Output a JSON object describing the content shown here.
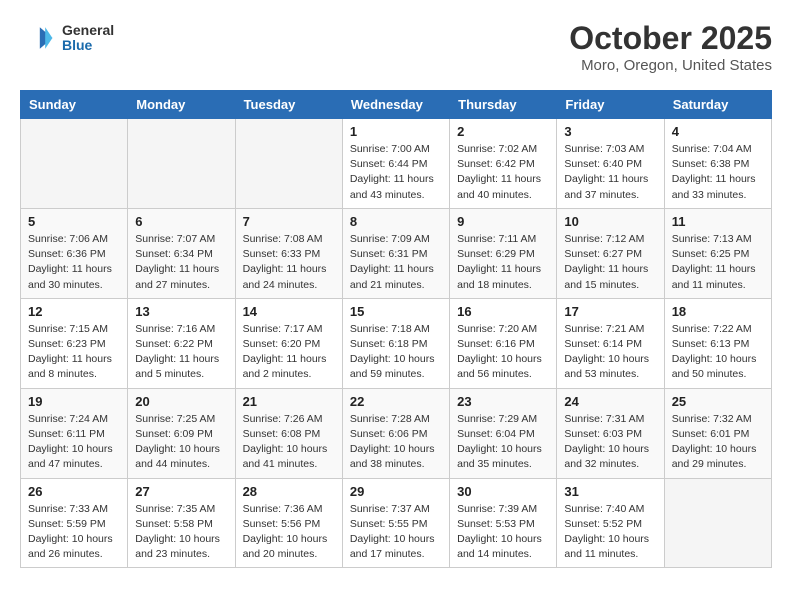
{
  "header": {
    "logo_general": "General",
    "logo_blue": "Blue",
    "month_title": "October 2025",
    "location": "Moro, Oregon, United States"
  },
  "weekdays": [
    "Sunday",
    "Monday",
    "Tuesday",
    "Wednesday",
    "Thursday",
    "Friday",
    "Saturday"
  ],
  "weeks": [
    [
      {
        "day": "",
        "info": ""
      },
      {
        "day": "",
        "info": ""
      },
      {
        "day": "",
        "info": ""
      },
      {
        "day": "1",
        "info": "Sunrise: 7:00 AM\nSunset: 6:44 PM\nDaylight: 11 hours\nand 43 minutes."
      },
      {
        "day": "2",
        "info": "Sunrise: 7:02 AM\nSunset: 6:42 PM\nDaylight: 11 hours\nand 40 minutes."
      },
      {
        "day": "3",
        "info": "Sunrise: 7:03 AM\nSunset: 6:40 PM\nDaylight: 11 hours\nand 37 minutes."
      },
      {
        "day": "4",
        "info": "Sunrise: 7:04 AM\nSunset: 6:38 PM\nDaylight: 11 hours\nand 33 minutes."
      }
    ],
    [
      {
        "day": "5",
        "info": "Sunrise: 7:06 AM\nSunset: 6:36 PM\nDaylight: 11 hours\nand 30 minutes."
      },
      {
        "day": "6",
        "info": "Sunrise: 7:07 AM\nSunset: 6:34 PM\nDaylight: 11 hours\nand 27 minutes."
      },
      {
        "day": "7",
        "info": "Sunrise: 7:08 AM\nSunset: 6:33 PM\nDaylight: 11 hours\nand 24 minutes."
      },
      {
        "day": "8",
        "info": "Sunrise: 7:09 AM\nSunset: 6:31 PM\nDaylight: 11 hours\nand 21 minutes."
      },
      {
        "day": "9",
        "info": "Sunrise: 7:11 AM\nSunset: 6:29 PM\nDaylight: 11 hours\nand 18 minutes."
      },
      {
        "day": "10",
        "info": "Sunrise: 7:12 AM\nSunset: 6:27 PM\nDaylight: 11 hours\nand 15 minutes."
      },
      {
        "day": "11",
        "info": "Sunrise: 7:13 AM\nSunset: 6:25 PM\nDaylight: 11 hours\nand 11 minutes."
      }
    ],
    [
      {
        "day": "12",
        "info": "Sunrise: 7:15 AM\nSunset: 6:23 PM\nDaylight: 11 hours\nand 8 minutes."
      },
      {
        "day": "13",
        "info": "Sunrise: 7:16 AM\nSunset: 6:22 PM\nDaylight: 11 hours\nand 5 minutes."
      },
      {
        "day": "14",
        "info": "Sunrise: 7:17 AM\nSunset: 6:20 PM\nDaylight: 11 hours\nand 2 minutes."
      },
      {
        "day": "15",
        "info": "Sunrise: 7:18 AM\nSunset: 6:18 PM\nDaylight: 10 hours\nand 59 minutes."
      },
      {
        "day": "16",
        "info": "Sunrise: 7:20 AM\nSunset: 6:16 PM\nDaylight: 10 hours\nand 56 minutes."
      },
      {
        "day": "17",
        "info": "Sunrise: 7:21 AM\nSunset: 6:14 PM\nDaylight: 10 hours\nand 53 minutes."
      },
      {
        "day": "18",
        "info": "Sunrise: 7:22 AM\nSunset: 6:13 PM\nDaylight: 10 hours\nand 50 minutes."
      }
    ],
    [
      {
        "day": "19",
        "info": "Sunrise: 7:24 AM\nSunset: 6:11 PM\nDaylight: 10 hours\nand 47 minutes."
      },
      {
        "day": "20",
        "info": "Sunrise: 7:25 AM\nSunset: 6:09 PM\nDaylight: 10 hours\nand 44 minutes."
      },
      {
        "day": "21",
        "info": "Sunrise: 7:26 AM\nSunset: 6:08 PM\nDaylight: 10 hours\nand 41 minutes."
      },
      {
        "day": "22",
        "info": "Sunrise: 7:28 AM\nSunset: 6:06 PM\nDaylight: 10 hours\nand 38 minutes."
      },
      {
        "day": "23",
        "info": "Sunrise: 7:29 AM\nSunset: 6:04 PM\nDaylight: 10 hours\nand 35 minutes."
      },
      {
        "day": "24",
        "info": "Sunrise: 7:31 AM\nSunset: 6:03 PM\nDaylight: 10 hours\nand 32 minutes."
      },
      {
        "day": "25",
        "info": "Sunrise: 7:32 AM\nSunset: 6:01 PM\nDaylight: 10 hours\nand 29 minutes."
      }
    ],
    [
      {
        "day": "26",
        "info": "Sunrise: 7:33 AM\nSunset: 5:59 PM\nDaylight: 10 hours\nand 26 minutes."
      },
      {
        "day": "27",
        "info": "Sunrise: 7:35 AM\nSunset: 5:58 PM\nDaylight: 10 hours\nand 23 minutes."
      },
      {
        "day": "28",
        "info": "Sunrise: 7:36 AM\nSunset: 5:56 PM\nDaylight: 10 hours\nand 20 minutes."
      },
      {
        "day": "29",
        "info": "Sunrise: 7:37 AM\nSunset: 5:55 PM\nDaylight: 10 hours\nand 17 minutes."
      },
      {
        "day": "30",
        "info": "Sunrise: 7:39 AM\nSunset: 5:53 PM\nDaylight: 10 hours\nand 14 minutes."
      },
      {
        "day": "31",
        "info": "Sunrise: 7:40 AM\nSunset: 5:52 PM\nDaylight: 10 hours\nand 11 minutes."
      },
      {
        "day": "",
        "info": ""
      }
    ]
  ]
}
